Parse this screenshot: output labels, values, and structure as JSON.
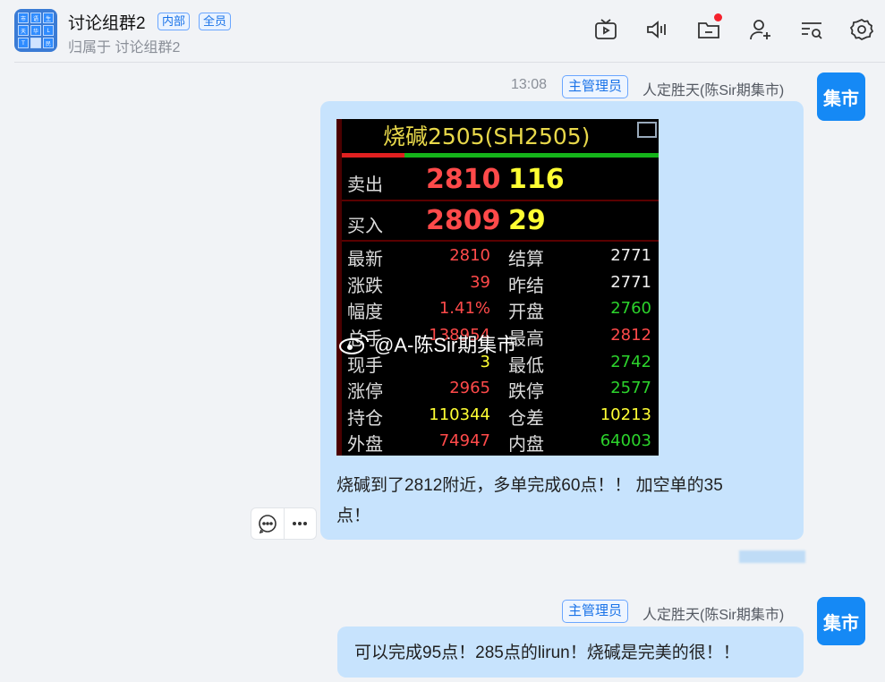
{
  "header": {
    "group_name": "讨论组群2",
    "tag_internal": "内部",
    "tag_all": "全员",
    "subtitle": "归属于 讨论组群2",
    "avatar_cells": [
      "市",
      "语",
      "生",
      "天",
      "华",
      "L",
      "T",
      "",
      "民"
    ],
    "toolbar_icons": [
      "tv-icon",
      "speaker-icon",
      "folder-minus-icon",
      "add-user-icon",
      "search-list-icon",
      "gear-icon"
    ]
  },
  "messages": [
    {
      "time": "13:08",
      "role": "主管理员",
      "sender": "人定胜天(陈Sir期集市)",
      "avatar": "集市",
      "image": {
        "title": "烧碱2505(SH2505)",
        "sell_label": "卖出",
        "sell_price": "2810",
        "sell_volume": "116",
        "buy_label": "买入",
        "buy_price": "2809",
        "buy_volume": "29",
        "rows": [
          {
            "l1": "最新",
            "v1": "2810",
            "l2": "结算",
            "v2": "2771"
          },
          {
            "l1": "涨跌",
            "v1": "39",
            "l2": "昨结",
            "v2": "2771"
          },
          {
            "l1": "幅度",
            "v1": "1.41%",
            "l2": "开盘",
            "v2": "2760"
          },
          {
            "l1": "总手",
            "v1": "138954",
            "l2": "最高",
            "v2": "2812"
          },
          {
            "l1": "现手",
            "v1": "3",
            "l2": "最低",
            "v2": "2742"
          },
          {
            "l1": "涨停",
            "v1": "2965",
            "l2": "跌停",
            "v2": "2577"
          },
          {
            "l1": "持仓",
            "v1": "110344",
            "l2": "仓差",
            "v2": "10213"
          },
          {
            "l1": "外盘",
            "v1": "74947",
            "l2": "内盘",
            "v2": "64003"
          }
        ],
        "watermark": "@A-陈Sir期集市"
      },
      "text_line1": "烧碱到了2812附近，多单完成60点！！ 加空单的35",
      "text_line2": "点！"
    },
    {
      "role": "主管理员",
      "sender": "人定胜天(陈Sir期集市)",
      "avatar": "集市",
      "text": "可以完成95点！285点的lirun！烧碱是完美的很！！"
    }
  ]
}
